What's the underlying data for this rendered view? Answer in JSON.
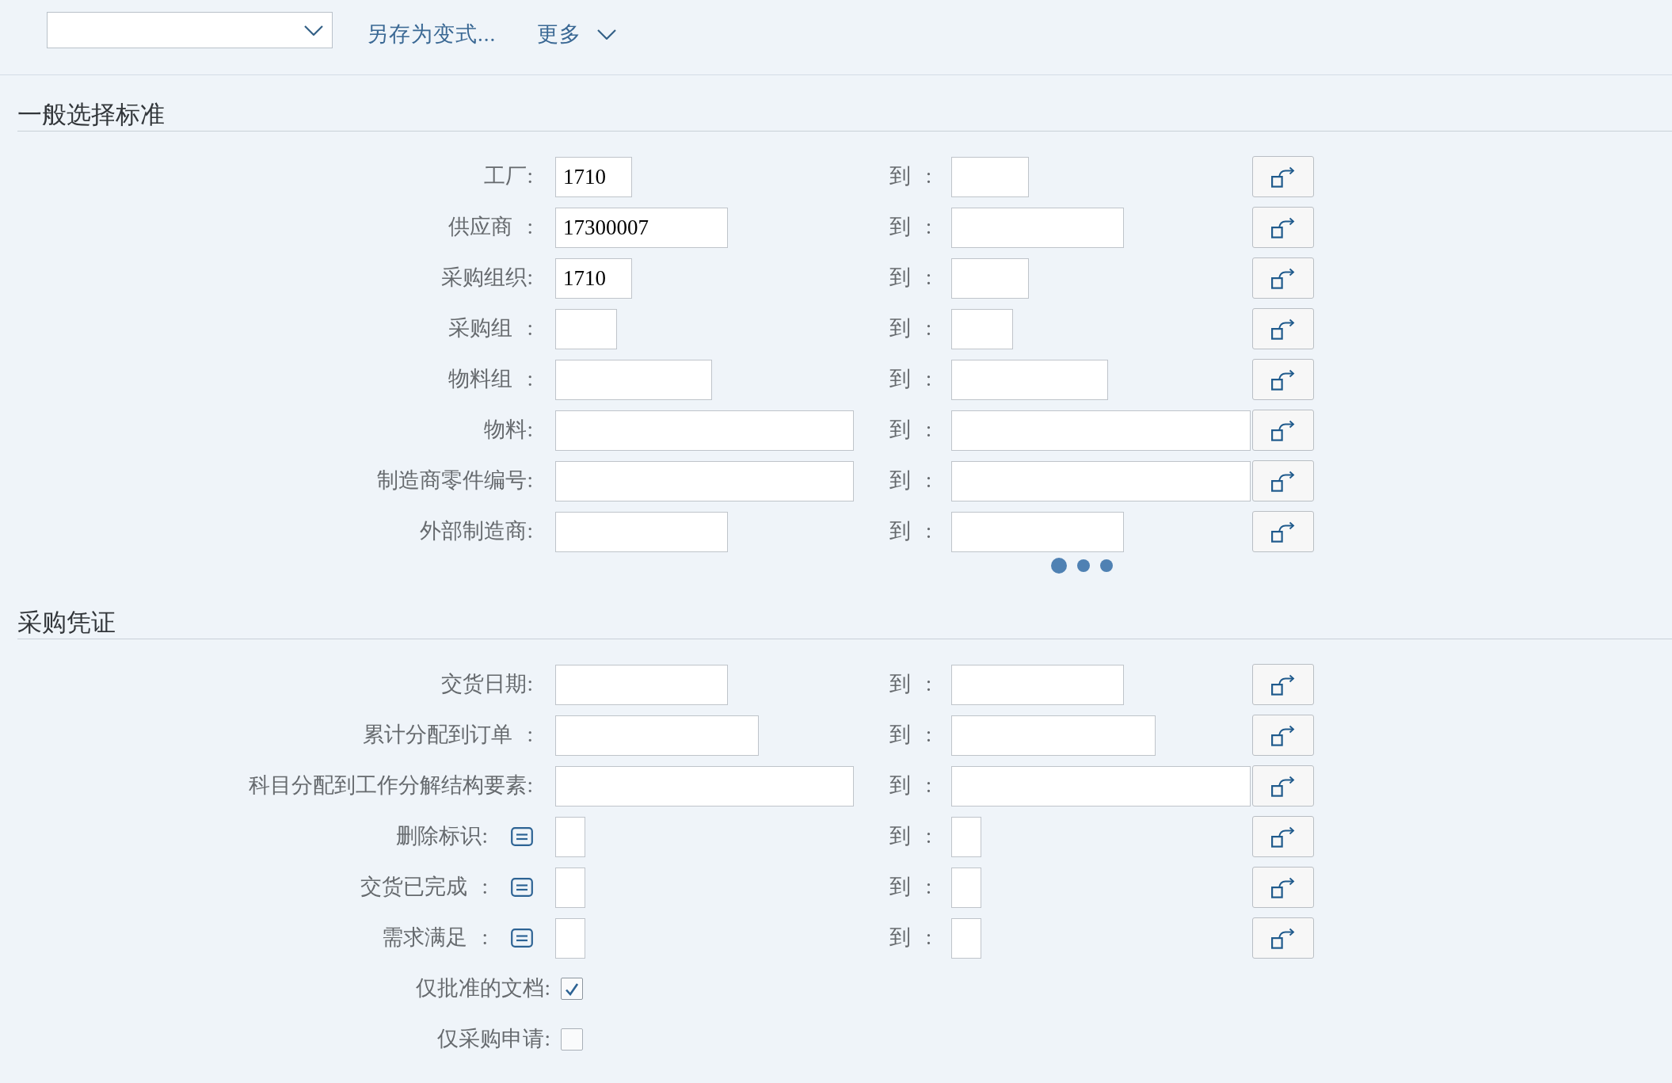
{
  "toolbar": {
    "save_as_variant": "另存为变式...",
    "more": "更多"
  },
  "sections": [
    {
      "title": "一般选择标准",
      "loading": true,
      "rows": [
        {
          "kind": "range",
          "label": "工厂:",
          "value": "1710",
          "to_label": "到 :"
        },
        {
          "kind": "range",
          "label": "供应商 :",
          "value": "17300007",
          "to_label": "到 :"
        },
        {
          "kind": "range",
          "label": "采购组织:",
          "value": "1710",
          "to_label": "到 :"
        },
        {
          "kind": "range",
          "label": "采购组 :",
          "to_label": "到 :"
        },
        {
          "kind": "range",
          "label": "物料组 :",
          "to_label": "到 :"
        },
        {
          "kind": "range",
          "label": "物料:",
          "to_label": "到 :"
        },
        {
          "kind": "range",
          "label": "制造商零件编号:",
          "to_label": "到 :"
        },
        {
          "kind": "range",
          "label": "外部制造商:",
          "to_label": "到 :"
        }
      ]
    },
    {
      "title": "采购凭证",
      "loading": false,
      "rows": [
        {
          "kind": "range",
          "label": "交货日期:",
          "to_label": "到 :"
        },
        {
          "kind": "range",
          "label": "累计分配到订单 :",
          "to_label": "到 :"
        },
        {
          "kind": "range",
          "label": "科目分配到工作分解结构要素:",
          "to_label": "到 :"
        },
        {
          "kind": "range_help",
          "label": "删除标识:",
          "to_label": "到 :"
        },
        {
          "kind": "range_help",
          "label": "交货已完成 :",
          "to_label": "到 :"
        },
        {
          "kind": "range_help",
          "label": "需求满足 :",
          "to_label": "到 :"
        },
        {
          "kind": "checkbox",
          "label": "仅批准的文档:",
          "checked": true
        },
        {
          "kind": "checkbox",
          "label": "仅采购申请:",
          "checked": false
        }
      ]
    }
  ]
}
